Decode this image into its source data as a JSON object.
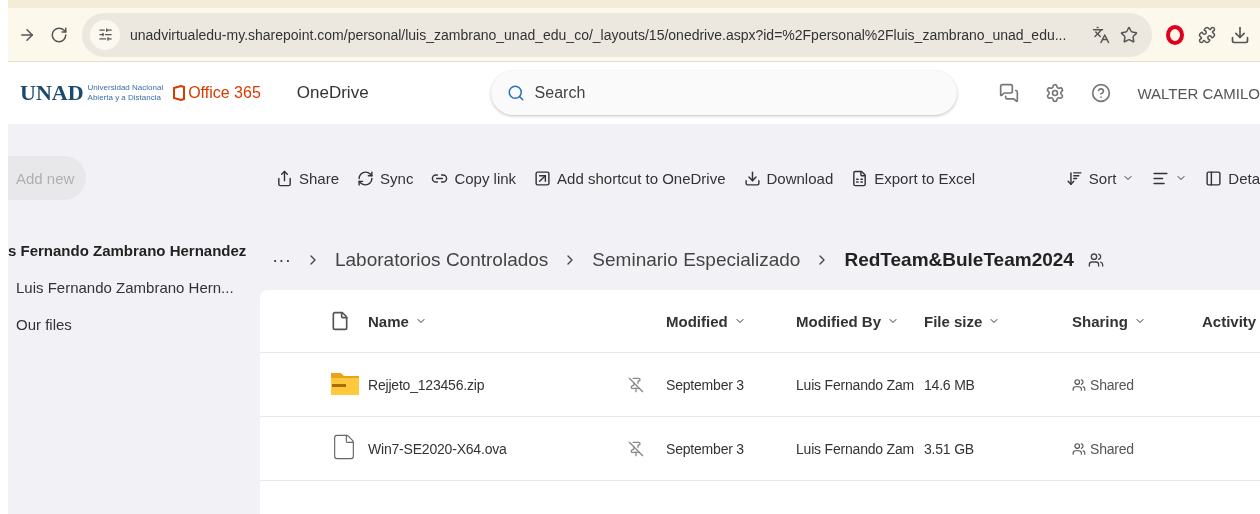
{
  "browser": {
    "url": "unadvirtualedu-my.sharepoint.com/personal/luis_zambrano_unad_edu_co/_layouts/15/onedrive.aspx?id=%2Fpersonal%2Fluis_zambrano_unad_edu..."
  },
  "header": {
    "logo": "UNAD",
    "logo_line_1": "Universidad Nacional",
    "logo_line_2": "Abierta y a Distancia",
    "suite": "Office 365",
    "app": "OneDrive",
    "search": {
      "placeholder": "Search"
    },
    "user": "WALTER CAMILO"
  },
  "sidebar": {
    "add_new": {
      "label": "Add new",
      "disabled": true
    },
    "heading": "s Fernando Zambrano Hernandez",
    "items": [
      {
        "label": "Luis Fernando Zambrano Hern..."
      },
      {
        "label": "Our files"
      }
    ]
  },
  "commands": [
    {
      "kind": "share",
      "label": "Share"
    },
    {
      "kind": "sync",
      "label": "Sync"
    },
    {
      "kind": "link",
      "label": "Copy link"
    },
    {
      "kind": "shortcut",
      "label": "Add shortcut to OneDrive"
    },
    {
      "kind": "download",
      "label": "Download"
    },
    {
      "kind": "excel",
      "label": "Export to Excel"
    }
  ],
  "view_commands": [
    {
      "kind": "sort",
      "label": "Sort"
    },
    {
      "kind": "view"
    },
    {
      "kind": "details",
      "label": "Deta"
    }
  ],
  "breadcrumb": {
    "overflow": "···",
    "items": [
      "Laboratorios Controlados",
      "Seminario Especializado",
      "RedTeam&BuleTeam2024"
    ]
  },
  "table": {
    "columns": [
      "Name",
      "Modified",
      "Modified By",
      "File size",
      "Sharing",
      "Activity"
    ],
    "rows": [
      {
        "kind": "zip",
        "name": "Rejjeto_123456.zip",
        "modified": "September 3",
        "modified_by": "Luis Fernando Zam",
        "size": "14.6 MB",
        "sharing": "Shared"
      },
      {
        "kind": "file",
        "name": "Win7-SE2020-X64.ova",
        "modified": "September 3",
        "modified_by": "Luis Fernando Zam",
        "size": "3.51 GB",
        "sharing": "Shared"
      }
    ]
  }
}
